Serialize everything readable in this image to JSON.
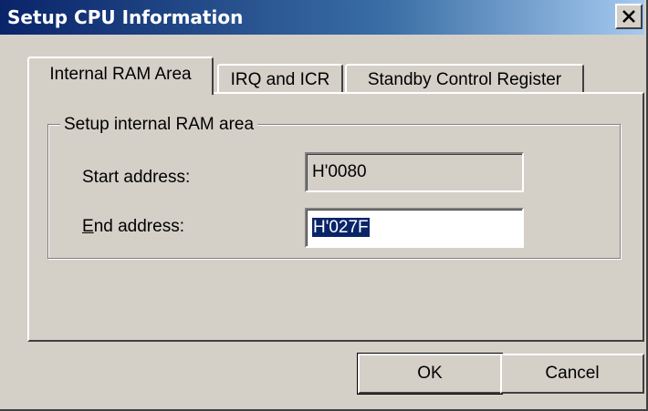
{
  "window": {
    "title": "Setup CPU Information",
    "close_label": "✕"
  },
  "tabs": [
    {
      "label": "Internal RAM Area",
      "active": true
    },
    {
      "label": "IRQ and ICR",
      "active": false
    },
    {
      "label": "Standby Control Register",
      "active": false
    }
  ],
  "group": {
    "label": "Setup internal RAM area"
  },
  "fields": {
    "start": {
      "label": "Start address:",
      "value": "H'0080"
    },
    "end": {
      "label_mnemonic": "E",
      "label_rest": "nd address:",
      "value": "H'027F"
    }
  },
  "buttons": {
    "ok": "OK",
    "cancel": "Cancel"
  }
}
